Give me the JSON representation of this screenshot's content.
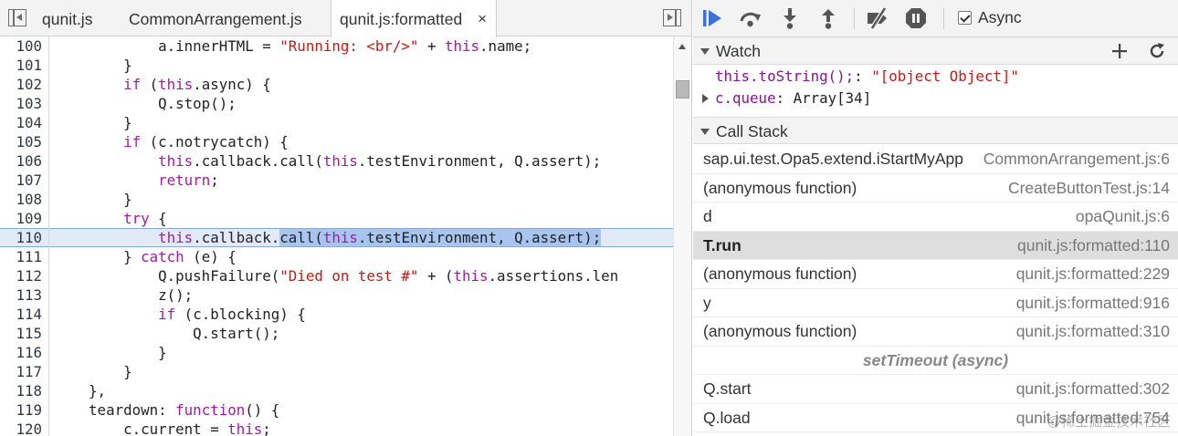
{
  "editor": {
    "tabs": [
      {
        "label": "qunit.js"
      },
      {
        "label": "CommonArrangement.js"
      },
      {
        "label": "qunit.js:formatted",
        "close": "×"
      }
    ],
    "lines": [
      {
        "n": "100",
        "segs": [
          [
            "t",
            "            a.innerHTML = "
          ],
          [
            "s",
            "\"Running: <br/>\""
          ],
          [
            "t",
            " + "
          ],
          [
            "k",
            "this"
          ],
          [
            "t",
            ".name;"
          ]
        ]
      },
      {
        "n": "101",
        "segs": [
          [
            "t",
            "        }"
          ]
        ]
      },
      {
        "n": "102",
        "segs": [
          [
            "t",
            "        "
          ],
          [
            "k",
            "if"
          ],
          [
            "t",
            " ("
          ],
          [
            "k",
            "this"
          ],
          [
            "t",
            ".async) {"
          ]
        ]
      },
      {
        "n": "103",
        "segs": [
          [
            "t",
            "            Q.stop();"
          ]
        ]
      },
      {
        "n": "104",
        "segs": [
          [
            "t",
            "        }"
          ]
        ]
      },
      {
        "n": "105",
        "segs": [
          [
            "t",
            "        "
          ],
          [
            "k",
            "if"
          ],
          [
            "t",
            " (c.notrycatch) {"
          ]
        ]
      },
      {
        "n": "106",
        "segs": [
          [
            "t",
            "            "
          ],
          [
            "k",
            "this"
          ],
          [
            "t",
            ".callback.call("
          ],
          [
            "k",
            "this"
          ],
          [
            "t",
            ".testEnvironment, Q.assert);"
          ]
        ]
      },
      {
        "n": "107",
        "segs": [
          [
            "t",
            "            "
          ],
          [
            "k",
            "return"
          ],
          [
            "t",
            ";"
          ]
        ]
      },
      {
        "n": "108",
        "segs": [
          [
            "t",
            "        }"
          ]
        ]
      },
      {
        "n": "109",
        "segs": [
          [
            "t",
            "        "
          ],
          [
            "k",
            "try"
          ],
          [
            "t",
            " {"
          ]
        ]
      },
      {
        "n": "110",
        "exec": true,
        "segs": [
          [
            "t",
            "            "
          ],
          [
            "k",
            "this"
          ],
          [
            "t",
            ".callback."
          ],
          [
            "sel",
            "call("
          ],
          [
            "selk",
            "this"
          ],
          [
            "sel",
            ".testEnvironment, Q.assert);"
          ]
        ]
      },
      {
        "n": "111",
        "segs": [
          [
            "t",
            "        } "
          ],
          [
            "k",
            "catch"
          ],
          [
            "t",
            " (e) {"
          ]
        ]
      },
      {
        "n": "112",
        "segs": [
          [
            "t",
            "            Q.pushFailure("
          ],
          [
            "s",
            "\"Died on test #\""
          ],
          [
            "t",
            " + ("
          ],
          [
            "k",
            "this"
          ],
          [
            "t",
            ".assertions.len"
          ]
        ]
      },
      {
        "n": "113",
        "segs": [
          [
            "t",
            "            z();"
          ]
        ]
      },
      {
        "n": "114",
        "segs": [
          [
            "t",
            "            "
          ],
          [
            "k",
            "if"
          ],
          [
            "t",
            " (c.blocking) {"
          ]
        ]
      },
      {
        "n": "115",
        "segs": [
          [
            "t",
            "                Q.start();"
          ]
        ]
      },
      {
        "n": "116",
        "segs": [
          [
            "t",
            "            }"
          ]
        ]
      },
      {
        "n": "117",
        "segs": [
          [
            "t",
            "        }"
          ]
        ]
      },
      {
        "n": "118",
        "segs": [
          [
            "t",
            "    },"
          ]
        ]
      },
      {
        "n": "119",
        "segs": [
          [
            "t",
            "    teardown: "
          ],
          [
            "k",
            "function"
          ],
          [
            "t",
            "() {"
          ]
        ]
      },
      {
        "n": "120",
        "segs": [
          [
            "t",
            "        c.current = "
          ],
          [
            "k",
            "this"
          ],
          [
            "t",
            ";"
          ]
        ]
      }
    ],
    "colors": {
      "keyword": "#a31aa3",
      "string": "#c41a16",
      "selection": "#a8c4f0",
      "exec_line": "#e1ebf8"
    }
  },
  "toolbar": {
    "buttons": [
      "resume-icon",
      "step-over-icon",
      "step-into-icon",
      "step-out-icon",
      "deactivate-breakpoints-icon",
      "pause-on-exceptions-icon"
    ],
    "async_label": "Async",
    "async_checked": true,
    "accent": "#3b74d6"
  },
  "watch": {
    "title": "Watch",
    "add_icon": "plus-icon",
    "refresh_icon": "refresh-icon",
    "items": [
      {
        "expr": "this.toString();",
        "sep": ": ",
        "value": "\"[object Object]\""
      },
      {
        "expr": "c.queue",
        "sep": ": ",
        "value": "Array[34]"
      }
    ]
  },
  "callstack": {
    "title": "Call Stack",
    "frames": [
      {
        "fn": "sap.ui.test.Opa5.extend.iStartMyApp",
        "loc": "CommonArrangement.js:6"
      },
      {
        "fn": "(anonymous function)",
        "loc": "CreateButtonTest.js:14"
      },
      {
        "fn": "d",
        "loc": "opaQunit.js:6"
      },
      {
        "fn": "T.run",
        "loc": "qunit.js:formatted:110",
        "selected": true
      },
      {
        "fn": "(anonymous function)",
        "loc": "qunit.js:formatted:229"
      },
      {
        "fn": "y",
        "loc": "qunit.js:formatted:916"
      },
      {
        "fn": "(anonymous function)",
        "loc": "qunit.js:formatted:310"
      },
      {
        "async": "setTimeout (async)"
      },
      {
        "fn": "Q.start",
        "loc": "qunit.js:formatted:302"
      },
      {
        "fn": "Q.load",
        "loc": "qunit.js:formatted:754"
      }
    ]
  },
  "watermark": "@稀土掘金技术社区"
}
